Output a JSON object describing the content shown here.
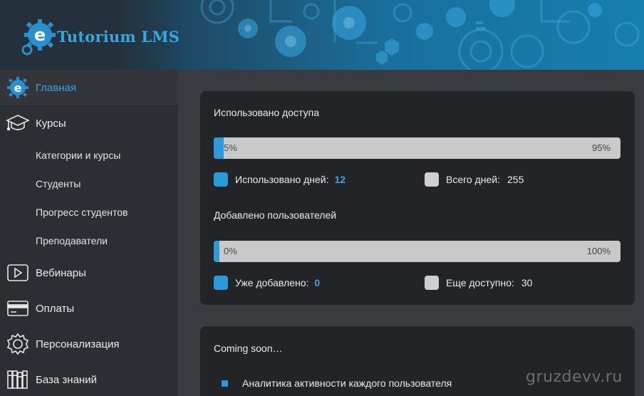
{
  "brand": {
    "name": "Tutorium LMS",
    "accent": "#2a9ad8"
  },
  "sidebar": {
    "items": [
      {
        "label": "Главная",
        "icon": "home-e-gear-icon",
        "active": true
      },
      {
        "label": "Курсы",
        "icon": "graduation-cap-icon"
      },
      {
        "label": "Категории и курсы"
      },
      {
        "label": "Студенты"
      },
      {
        "label": "Прогресс студентов"
      },
      {
        "label": "Преподаватели"
      },
      {
        "label": "Вебинары",
        "icon": "play-icon"
      },
      {
        "label": "Оплаты",
        "icon": "credit-card-icon"
      },
      {
        "label": "Персонализация",
        "icon": "gear-icon"
      },
      {
        "label": "База знаний",
        "icon": "books-icon"
      }
    ]
  },
  "access": {
    "title": "Использовано доступа",
    "used_percent_label": "5%",
    "remaining_percent_label": "95%",
    "used_fraction": 0.05,
    "used_days_label": "Использовано дней:",
    "used_days_value": "12",
    "total_days_label": "Всего дней:",
    "total_days_value": "255"
  },
  "users": {
    "title": "Добавлено пользователей",
    "used_percent_label": "0%",
    "remaining_percent_label": "100%",
    "used_fraction": 0.0,
    "added_label": "Уже добавлено:",
    "added_value": "0",
    "available_label": "Еще доступно:",
    "available_value": "30"
  },
  "coming_soon": {
    "title": "Coming soon…",
    "items": [
      "Аналитика активности каждого пользователя"
    ]
  },
  "watermark": "gruzdevv.ru"
}
